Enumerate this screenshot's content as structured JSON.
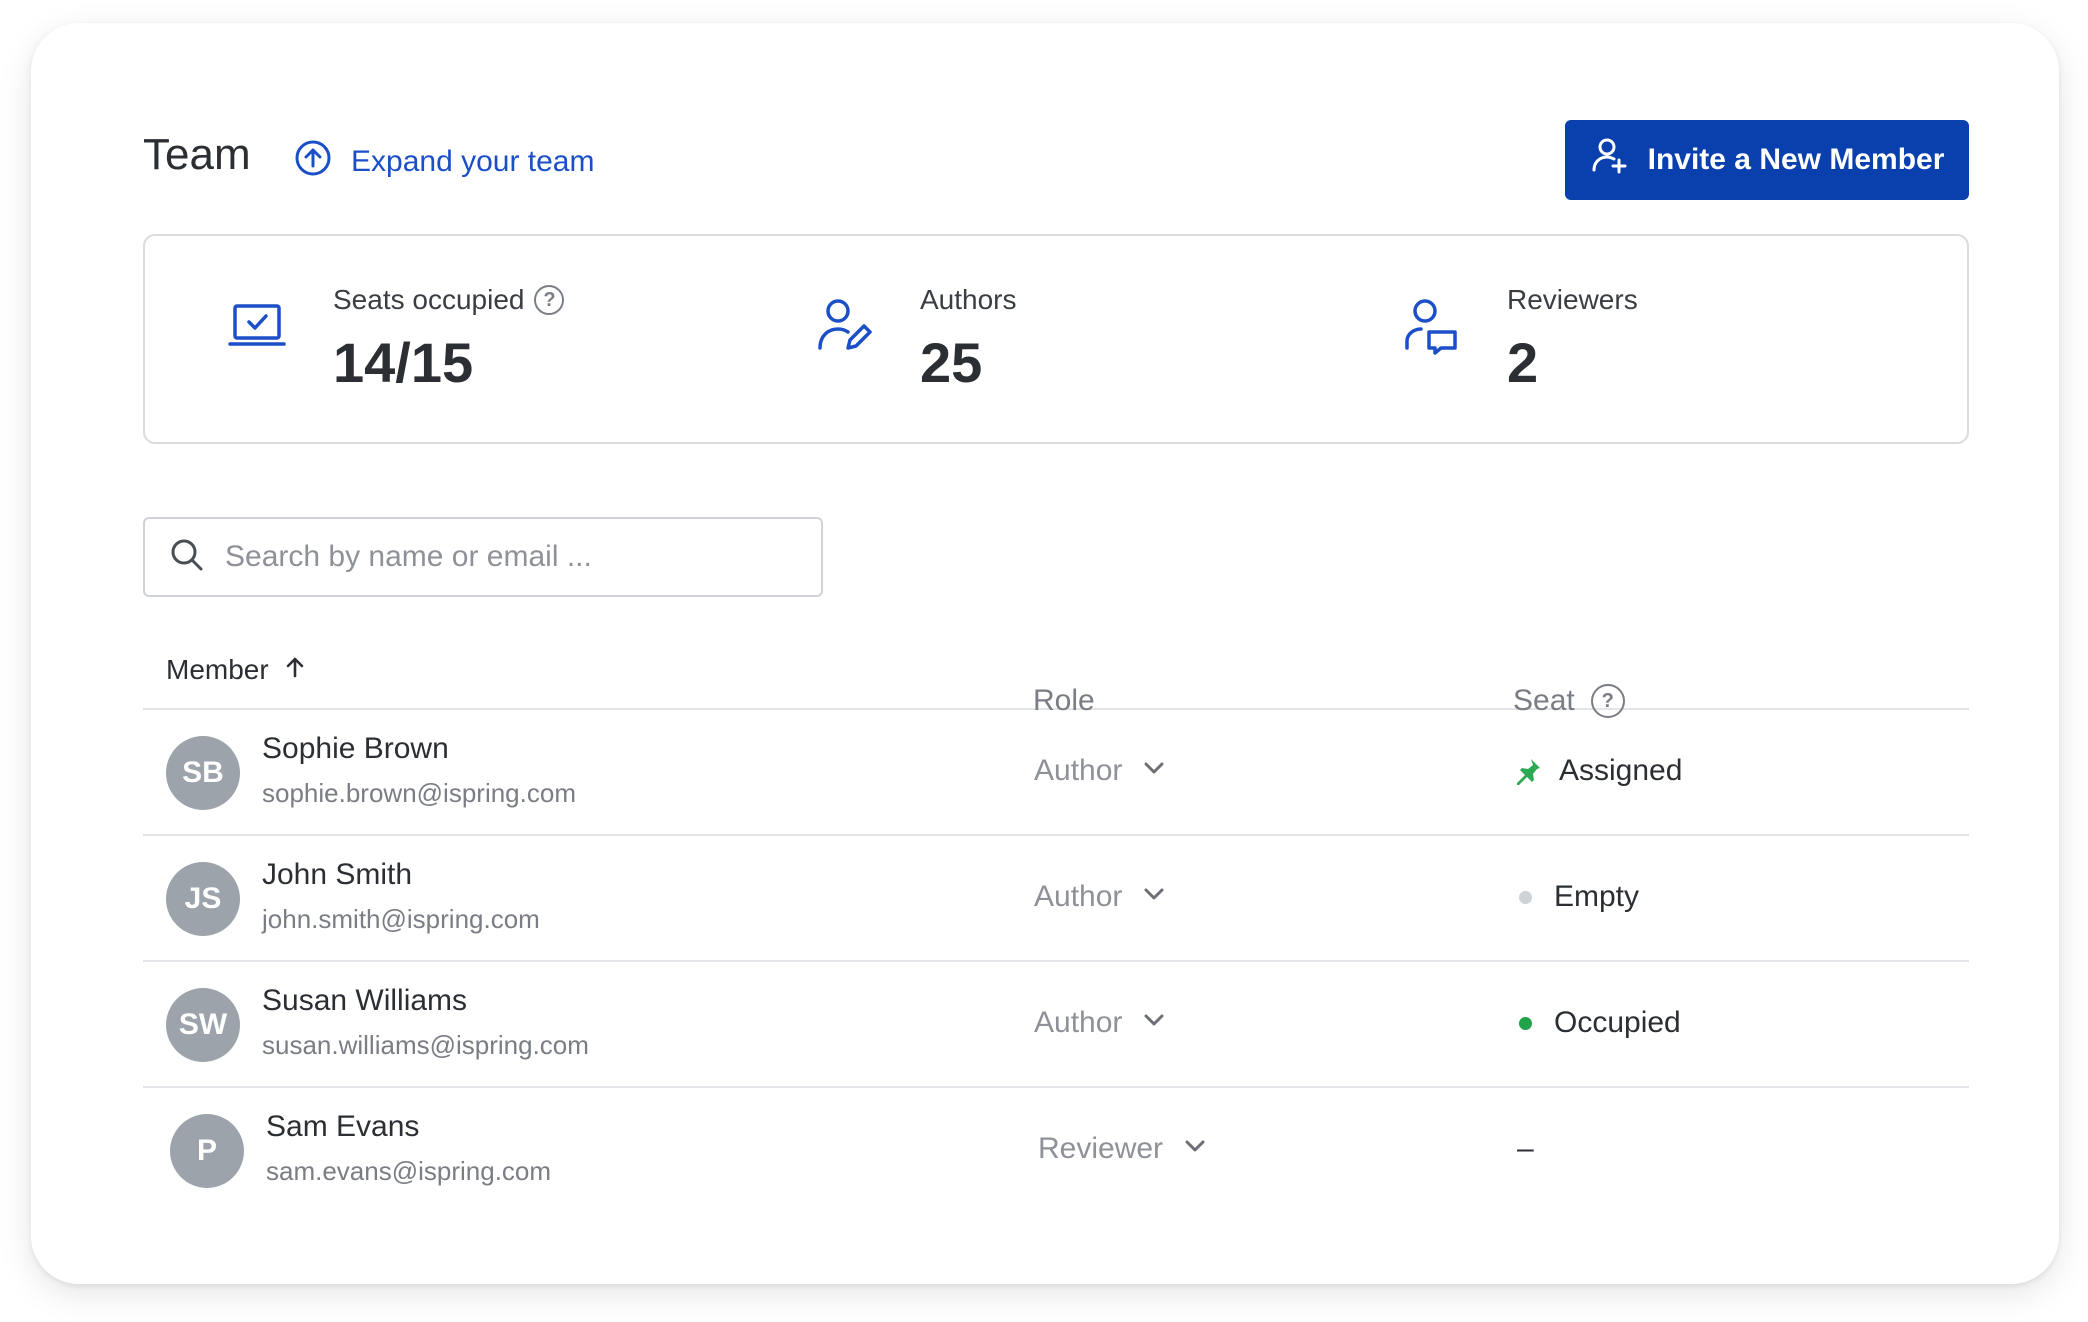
{
  "header": {
    "title": "Team",
    "expand_label": "Expand your team",
    "invite_label": "Invite a New Member",
    "accent_color": "#0a3fae"
  },
  "stats": [
    {
      "icon": "laptop-check-icon",
      "label": "Seats occupied",
      "value": "14/15",
      "has_help": true
    },
    {
      "icon": "user-pen-icon",
      "label": "Authors",
      "value": "25",
      "has_help": false
    },
    {
      "icon": "user-chat-icon",
      "label": "Reviewers",
      "value": "2",
      "has_help": false
    }
  ],
  "search": {
    "placeholder": "Search by name or email ...",
    "value": ""
  },
  "table": {
    "columns": {
      "member": "Member",
      "role": "Role",
      "seat": "Seat"
    },
    "sort": {
      "column": "Member",
      "direction": "ascending"
    },
    "rows": [
      {
        "initials": "SB",
        "name": "Sophie Brown",
        "email": "sophie.brown@ispring.com",
        "role": "Author",
        "seat": "Assigned",
        "seat_icon": "pin-icon",
        "seat_color": "#2eaa55"
      },
      {
        "initials": "JS",
        "name": "John Smith",
        "email": "john.smith@ispring.com",
        "role": "Author",
        "seat": "Empty",
        "seat_icon": "dot",
        "seat_color": "#cfd2d6"
      },
      {
        "initials": "SW",
        "name": "Susan Williams",
        "email": "susan.williams@ispring.com",
        "role": "Author",
        "seat": "Occupied",
        "seat_icon": "dot",
        "seat_color": "#22a24b"
      },
      {
        "initials": "P",
        "name": "Sam Evans",
        "email": "sam.evans@ispring.com",
        "role": "Reviewer",
        "seat": "–",
        "seat_icon": "none",
        "seat_color": "#2b2f33"
      }
    ]
  }
}
